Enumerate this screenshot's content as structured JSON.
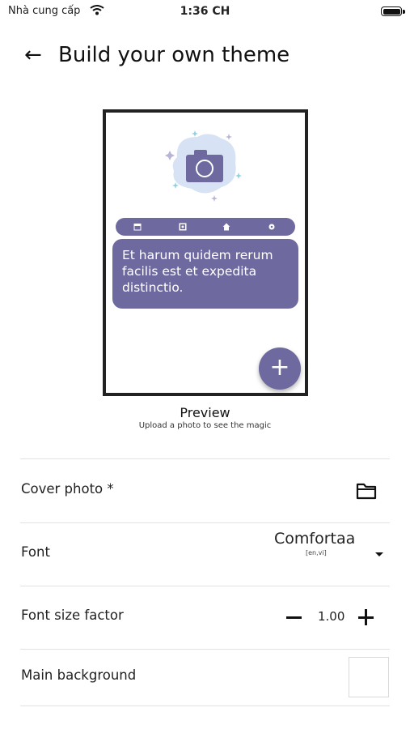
{
  "status_bar": {
    "carrier": "Nhà cung cấp",
    "time": "1:36 CH"
  },
  "header": {
    "back_icon": "arrow-left-icon",
    "title": "Build your own theme"
  },
  "preview": {
    "bubble_text": "Et harum quidem rerum facilis est et expedita distinctio.",
    "label": "Preview",
    "hint": "Upload a photo to see the magic",
    "accent_color": "#6e6a9f",
    "nav_icons": [
      "calendar-icon",
      "image-icon",
      "home-icon",
      "settings-icon"
    ]
  },
  "settings": {
    "cover_photo": {
      "label": "Cover photo *",
      "icon": "folder-icon"
    },
    "font": {
      "label": "Font",
      "value": "Comfortaa",
      "languages": "[en,vi]"
    },
    "font_size": {
      "label": "Font size factor",
      "value": "1.00"
    },
    "main_background": {
      "label": "Main background",
      "color": "#ffffff"
    }
  }
}
